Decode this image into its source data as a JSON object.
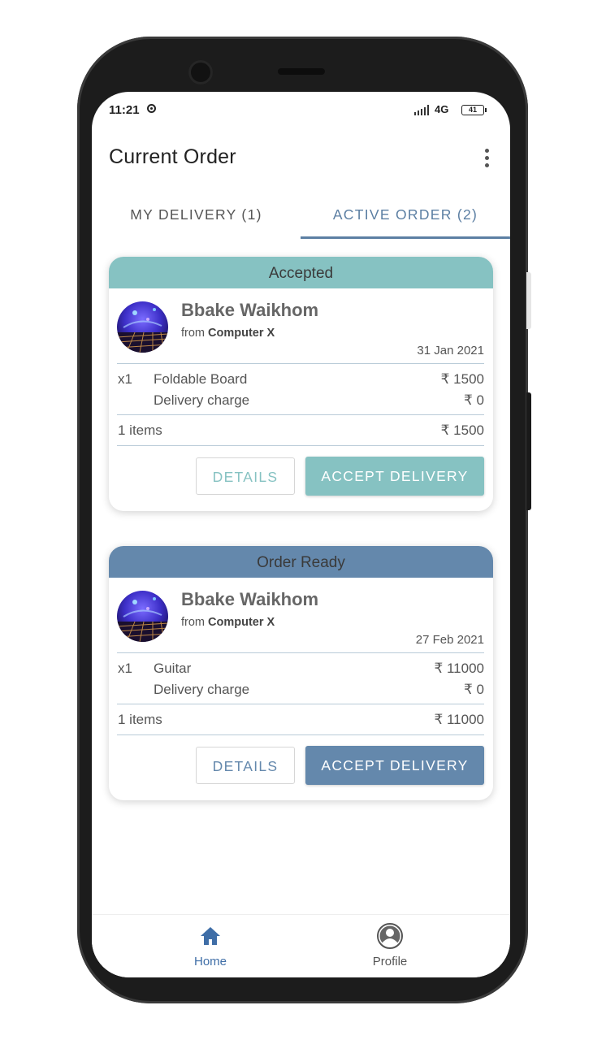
{
  "status_bar": {
    "time": "11:21",
    "network": "4G",
    "battery": "41"
  },
  "appbar": {
    "title": "Current Order",
    "menu_icon": "more-vert-icon"
  },
  "tabs": [
    {
      "label": "MY DELIVERY (1)",
      "active": false
    },
    {
      "label": "ACTIVE ORDER (2)",
      "active": true
    }
  ],
  "colors": {
    "accepted": "#86c2c2",
    "ready": "#6488ac",
    "active_tab": "#5c7fa3"
  },
  "orders": [
    {
      "status": "Accepted",
      "customer": "Bbake Waikhom",
      "from_prefix": "from",
      "store": "Computer X",
      "date": "31 Jan 2021",
      "items": [
        {
          "qty": "x1",
          "name": "Foldable Board",
          "price": "₹ 1500"
        }
      ],
      "delivery_label": "Delivery charge",
      "delivery_charge": "₹ 0",
      "items_count": "1 items",
      "total": "₹ 1500",
      "details_label": "DETAILS",
      "accept_label": "ACCEPT DELIVERY"
    },
    {
      "status": "Order Ready",
      "customer": "Bbake Waikhom",
      "from_prefix": "from",
      "store": "Computer X",
      "date": "27 Feb 2021",
      "items": [
        {
          "qty": "x1",
          "name": "Guitar",
          "price": "₹ 11000"
        }
      ],
      "delivery_label": "Delivery charge",
      "delivery_charge": "₹ 0",
      "items_count": "1 items",
      "total": "₹ 11000",
      "details_label": "DETAILS",
      "accept_label": "ACCEPT DELIVERY"
    }
  ],
  "bottom_nav": [
    {
      "label": "Home",
      "icon": "home-icon",
      "active": true
    },
    {
      "label": "Profile",
      "icon": "profile-icon",
      "active": false
    }
  ]
}
